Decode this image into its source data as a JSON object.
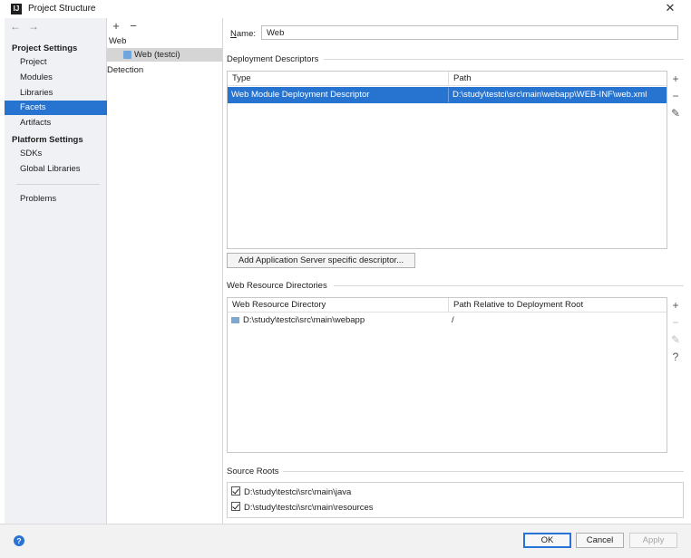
{
  "window": {
    "title": "Project Structure",
    "app_icon": "IJ",
    "close_glyph": "✕"
  },
  "sidebar": {
    "back_glyph": "←",
    "forward_glyph": "→",
    "project_settings_header": "Project Settings",
    "project_items": [
      {
        "label": "Project"
      },
      {
        "label": "Modules"
      },
      {
        "label": "Libraries"
      },
      {
        "label": "Facets",
        "selected": true
      },
      {
        "label": "Artifacts"
      }
    ],
    "platform_settings_header": "Platform Settings",
    "platform_items": [
      {
        "label": "SDKs"
      },
      {
        "label": "Global Libraries"
      }
    ],
    "problems_label": "Problems"
  },
  "tree": {
    "add_glyph": "+",
    "remove_glyph": "−",
    "group_web": "Web",
    "facet_web_testci": "Web (testci)",
    "group_detection": "Detection"
  },
  "main": {
    "name_label": "Name:",
    "name_value": "Web",
    "deployment_descriptors": {
      "title": "Deployment Descriptors",
      "columns": [
        "Type",
        "Path"
      ],
      "rows": [
        {
          "type": "Web Module Deployment Descriptor",
          "path": "D:\\study\\testci\\src\\main\\webapp\\WEB-INF\\web.xml",
          "selected": true
        }
      ],
      "add_server_descriptor_button": "Add Application Server specific descriptor..."
    },
    "web_resource_directories": {
      "title": "Web Resource Directories",
      "columns": [
        "Web Resource Directory",
        "Path Relative to Deployment Root"
      ],
      "rows": [
        {
          "directory": "D:\\study\\testci\\src\\main\\webapp",
          "relative_path": "/"
        }
      ]
    },
    "source_roots": {
      "title": "Source Roots",
      "items": [
        {
          "path": "D:\\study\\testci\\src\\main\\java",
          "checked": true
        },
        {
          "path": "D:\\study\\testci\\src\\main\\resources",
          "checked": true
        }
      ]
    },
    "side_glyphs": {
      "add": "+",
      "remove": "−",
      "edit": "✎",
      "help": "?"
    }
  },
  "footer": {
    "help_glyph": "?",
    "ok_label": "OK",
    "cancel_label": "Cancel",
    "apply_label": "Apply"
  },
  "colors": {
    "selection": "#2673d0",
    "sidebar_bg": "#eff1f5",
    "help_blue": "#2a73d6"
  }
}
